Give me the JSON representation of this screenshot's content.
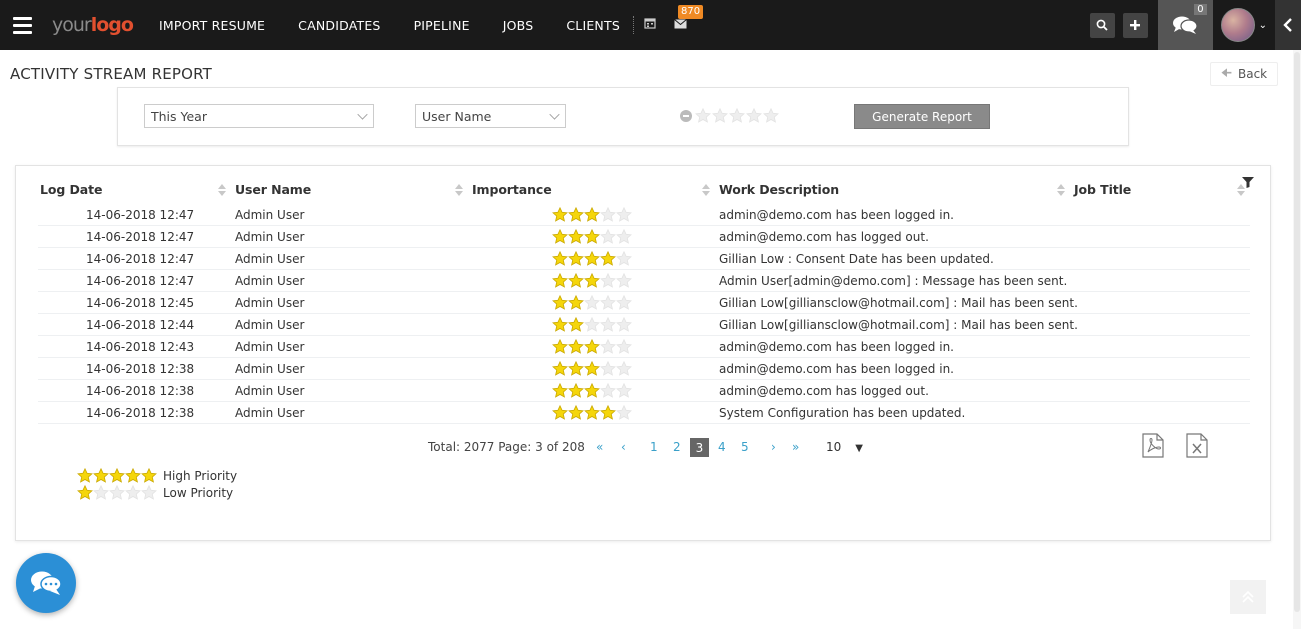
{
  "navbar": {
    "logo_part1": "your",
    "logo_part2": "logo",
    "items": [
      "IMPORT RESUME",
      "CANDIDATES",
      "PIPELINE",
      "JOBS",
      "CLIENTS"
    ],
    "mail_badge": "870",
    "chat_badge": "0"
  },
  "page": {
    "title": "ACTIVITY STREAM REPORT",
    "back_label": "Back"
  },
  "filters": {
    "period": "This Year",
    "user": "User Name",
    "importance_value": 0,
    "generate_label": "Generate Report"
  },
  "table": {
    "headers": [
      "Log Date",
      "User Name",
      "Importance",
      "Work Description",
      "Job Title"
    ],
    "rows": [
      {
        "date": "14-06-2018 12:47",
        "user": "Admin User",
        "importance": 3,
        "description": "admin@demo.com has been logged in.",
        "job": ""
      },
      {
        "date": "14-06-2018 12:47",
        "user": "Admin User",
        "importance": 3,
        "description": "admin@demo.com has logged out.",
        "job": ""
      },
      {
        "date": "14-06-2018 12:47",
        "user": "Admin User",
        "importance": 4,
        "description": "Gillian Low : Consent Date has been updated.",
        "job": ""
      },
      {
        "date": "14-06-2018 12:47",
        "user": "Admin User",
        "importance": 3,
        "description": "Admin User[admin@demo.com] : Message has been sent.",
        "job": ""
      },
      {
        "date": "14-06-2018 12:45",
        "user": "Admin User",
        "importance": 2,
        "description": "Gillian Low[gilliansclow@hotmail.com] : Mail has been sent.",
        "job": ""
      },
      {
        "date": "14-06-2018 12:44",
        "user": "Admin User",
        "importance": 2,
        "description": "Gillian Low[gilliansclow@hotmail.com] : Mail has been sent.",
        "job": ""
      },
      {
        "date": "14-06-2018 12:43",
        "user": "Admin User",
        "importance": 3,
        "description": "admin@demo.com has been logged in.",
        "job": ""
      },
      {
        "date": "14-06-2018 12:38",
        "user": "Admin User",
        "importance": 3,
        "description": "admin@demo.com has been logged in.",
        "job": ""
      },
      {
        "date": "14-06-2018 12:38",
        "user": "Admin User",
        "importance": 3,
        "description": "admin@demo.com has logged out.",
        "job": ""
      },
      {
        "date": "14-06-2018 12:38",
        "user": "Admin User",
        "importance": 4,
        "description": "System Configuration has been updated.",
        "job": ""
      }
    ]
  },
  "pagination": {
    "total_text": "Total: 2077 Page: 3 of 208",
    "first": "«",
    "prev": "‹",
    "pages": [
      "1",
      "2",
      "3",
      "4",
      "5"
    ],
    "current": "3",
    "next": "›",
    "last": "»",
    "page_size": "10"
  },
  "legend": {
    "high_label": "High Priority",
    "high_stars": 5,
    "low_label": "Low Priority",
    "low_stars": 1
  },
  "colors": {
    "navbar_bg": "#1a1a1a",
    "star_fill": "#f5d60b",
    "star_empty": "#eeeeee",
    "link": "#3aa0c9",
    "badge": "#f08a24",
    "chat_fab": "#2b8fd6"
  }
}
